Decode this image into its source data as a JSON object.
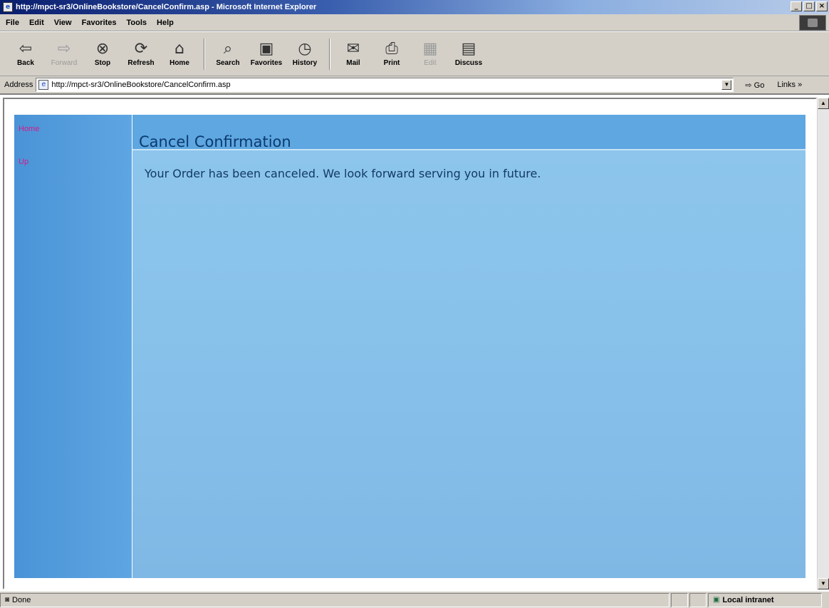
{
  "window": {
    "title": "http://mpct-sr3/OnlineBookstore/CancelConfirm.asp - Microsoft Internet Explorer",
    "controls": [
      "_",
      "□",
      "×"
    ]
  },
  "menubar": {
    "items": [
      "File",
      "Edit",
      "View",
      "Favorites",
      "Tools",
      "Help"
    ]
  },
  "toolbar": {
    "buttons": [
      {
        "label": "Back",
        "icon": "back-arrow-icon",
        "enabled": true
      },
      {
        "label": "Forward",
        "icon": "forward-arrow-icon",
        "enabled": false
      },
      {
        "label": "Stop",
        "icon": "stop-icon",
        "enabled": true
      },
      {
        "label": "Refresh",
        "icon": "refresh-icon",
        "enabled": true
      },
      {
        "label": "Home",
        "icon": "home-icon",
        "enabled": true
      },
      {
        "label": "Search",
        "icon": "search-icon",
        "enabled": true
      },
      {
        "label": "Favorites",
        "icon": "favorites-icon",
        "enabled": true
      },
      {
        "label": "History",
        "icon": "history-icon",
        "enabled": true
      },
      {
        "label": "Mail",
        "icon": "mail-icon",
        "enabled": true
      },
      {
        "label": "Print",
        "icon": "print-icon",
        "enabled": true
      },
      {
        "label": "Edit",
        "icon": "edit-icon",
        "enabled": false
      },
      {
        "label": "Discuss",
        "icon": "discuss-icon",
        "enabled": true
      }
    ]
  },
  "addressbar": {
    "label": "Address",
    "url": "http://mpct-sr3/OnlineBookstore/CancelConfirm.asp",
    "go_label": "Go",
    "links_label": "Links »"
  },
  "page": {
    "nav": {
      "home_label": "Home",
      "up_label": "Up"
    },
    "title": "Cancel Confirmation",
    "message": "Your Order has been canceled. We look forward serving you in future."
  },
  "statusbar": {
    "status_text": "Done",
    "zone_text": "Local intranet"
  },
  "colors": {
    "nav_pane": "#4a93d6",
    "main_pane": "#8ec6ec",
    "heading_bar": "#5ea7e1",
    "link": "#d41a8a"
  }
}
